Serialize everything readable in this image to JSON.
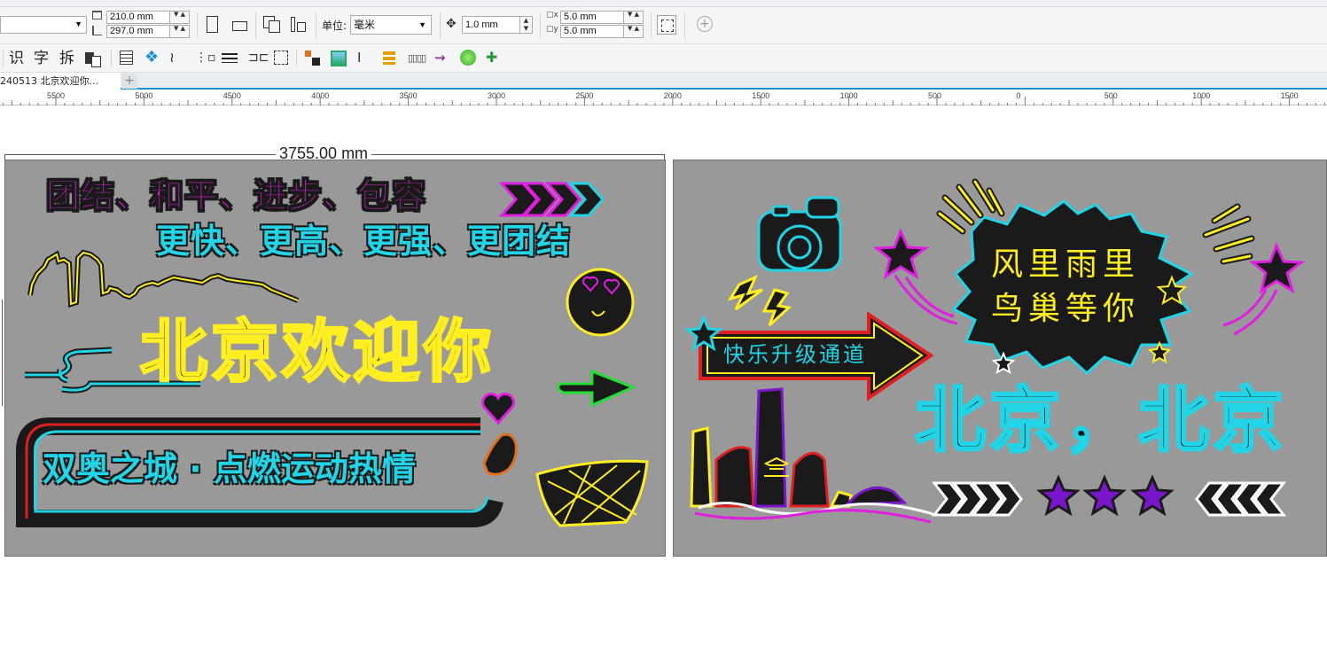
{
  "propbar": {
    "width_value": "210.0 mm",
    "height_value": "297.0 mm",
    "unit_label": "单位:",
    "unit_value": "毫米",
    "nudge_value": "1.0 mm",
    "dup_x_value": "5.0 mm",
    "dup_y_value": "5.0 mm"
  },
  "toolbar2": {
    "btn1": "识",
    "btn2": "字",
    "btn3": "拆"
  },
  "tabs": {
    "doc_tab": "240513 北京欢迎你..."
  },
  "ruler": {
    "labels": [
      "5500",
      "5000",
      "4500",
      "4000",
      "3500",
      "3000",
      "2500",
      "2000",
      "1500",
      "1000",
      "500",
      "0",
      "500",
      "1000",
      "1500"
    ]
  },
  "canvas": {
    "dimension_label": "3755.00 mm",
    "board1": {
      "line1": "团结、和平、进步、包容",
      "line2": "更快、更高、更强、更团结",
      "title": "北京欢迎你",
      "banner": "双奥之城 · 点燃运动热情"
    },
    "board2": {
      "bubble_line1": "风里雨里",
      "bubble_line2": "鸟巢等你",
      "arrow_text": "快乐升级通道",
      "big_title": "北京，北京"
    }
  },
  "colors": {
    "neon_magenta": "#e01ee0",
    "neon_cyan": "#22d4e6",
    "neon_yellow": "#ffee22",
    "neon_green": "#22dd33",
    "neon_red": "#e02020",
    "neon_purple": "#7a16c9",
    "board_gray": "#999999",
    "accent_blue": "#1c8fd6"
  }
}
